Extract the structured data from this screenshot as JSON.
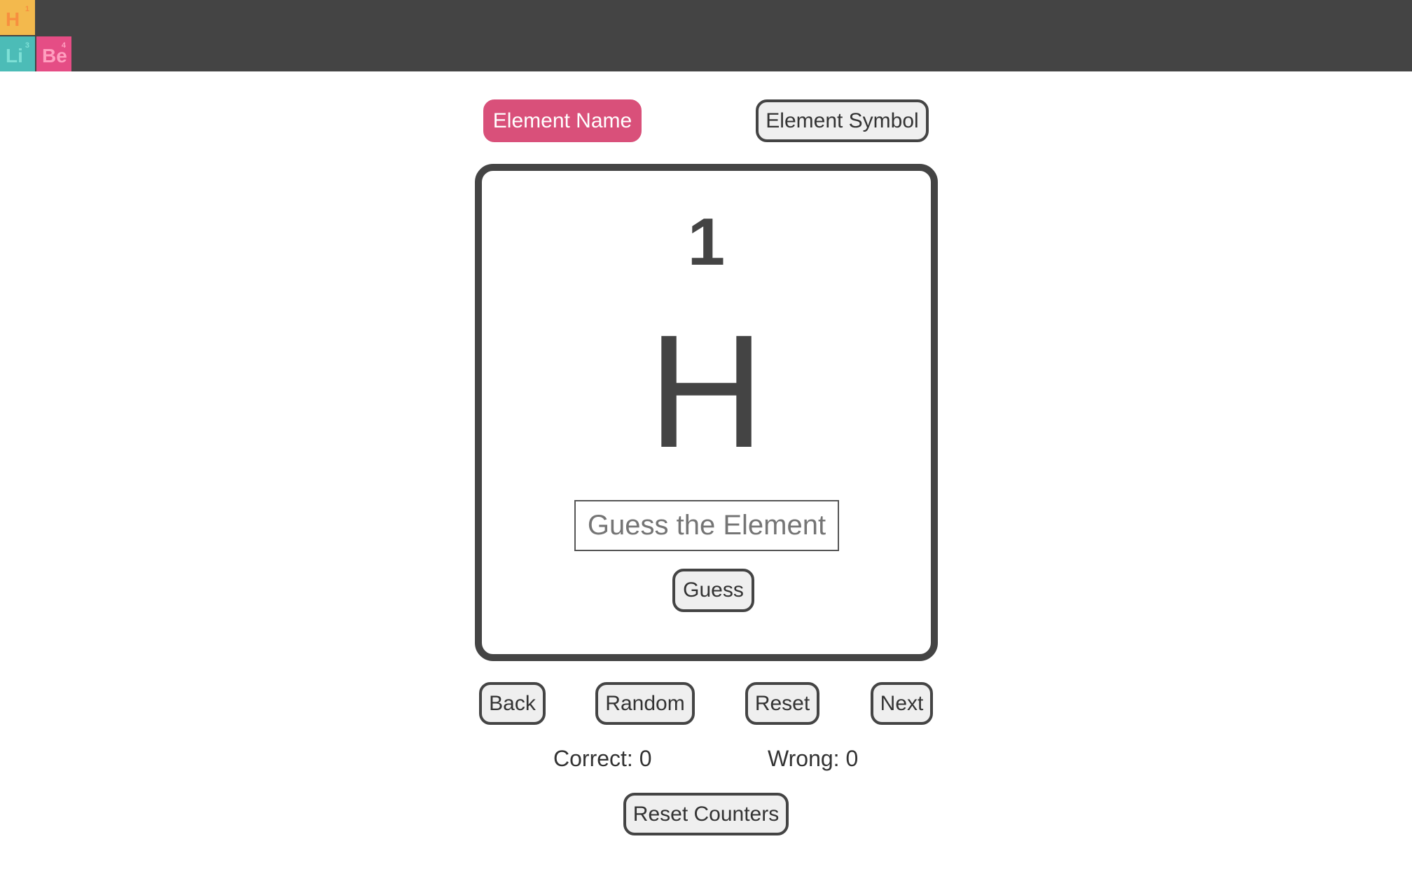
{
  "logo": {
    "tiles": [
      {
        "symbol": "H",
        "number": "1"
      },
      {
        "symbol": "Li",
        "number": "3"
      },
      {
        "symbol": "Be",
        "number": "4"
      }
    ]
  },
  "mode_toggle": {
    "element_name_label": "Element Name",
    "element_symbol_label": "Element Symbol",
    "active": "element_name"
  },
  "card": {
    "atomic_number": "1",
    "symbol": "H",
    "guess_input": {
      "value": "",
      "placeholder": "Guess the Element"
    },
    "guess_button_label": "Guess"
  },
  "navigation": {
    "back_label": "Back",
    "random_label": "Random",
    "reset_label": "Reset",
    "next_label": "Next"
  },
  "counters": {
    "correct_text": "Correct: 0",
    "wrong_text": "Wrong: 0",
    "reset_counters_label": "Reset Counters"
  },
  "colors": {
    "topbar": "#444444",
    "accent": "#d9507a",
    "tile_h": "#f3b94d",
    "tile_li": "#4cbcb7",
    "tile_be": "#e54d85"
  }
}
